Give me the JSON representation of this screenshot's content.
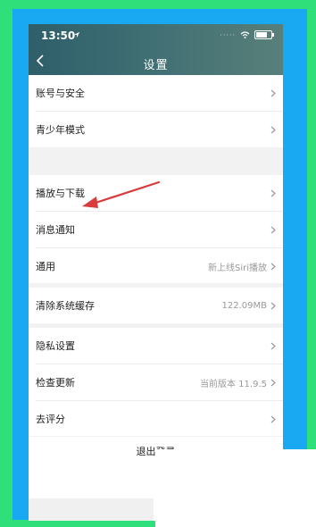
{
  "statusbar": {
    "time": "13:50",
    "dots": "·····"
  },
  "header": {
    "title": "设置"
  },
  "groups": [
    {
      "items": [
        {
          "label": "账号与安全",
          "value": ""
        },
        {
          "label": "青少年模式",
          "value": ""
        }
      ]
    },
    {
      "items": [
        {
          "label": "播放与下载",
          "value": ""
        },
        {
          "label": "消息通知",
          "value": ""
        },
        {
          "label": "通用",
          "value": "新上线Siri播放"
        }
      ]
    },
    {
      "items": [
        {
          "label": "清除系统缓存",
          "value": "122.09MB"
        }
      ]
    },
    {
      "items": [
        {
          "label": "隐私设置",
          "value": ""
        },
        {
          "label": "检查更新",
          "value": "当前版本 11.9.5"
        },
        {
          "label": "去评分",
          "value": ""
        }
      ]
    }
  ],
  "footer": {
    "logout_label": "退出登录"
  },
  "colors": {
    "annotation_arrow": "#d83b3b",
    "outer_border": "#2fe07a",
    "inner_border": "#19a9f2"
  }
}
